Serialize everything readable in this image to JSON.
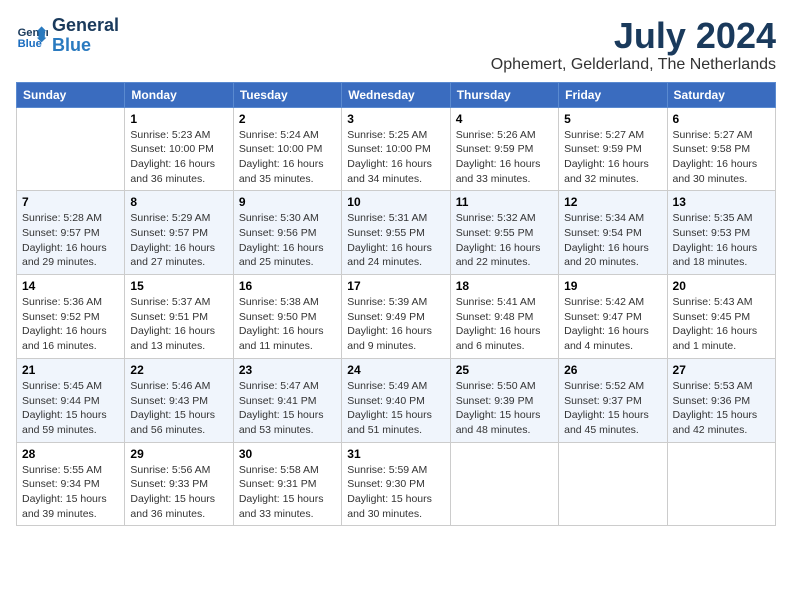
{
  "header": {
    "logo_line1": "General",
    "logo_line2": "Blue",
    "month_year": "July 2024",
    "location": "Ophemert, Gelderland, The Netherlands"
  },
  "days_of_week": [
    "Sunday",
    "Monday",
    "Tuesday",
    "Wednesday",
    "Thursday",
    "Friday",
    "Saturday"
  ],
  "weeks": [
    [
      {
        "day": "",
        "info": ""
      },
      {
        "day": "1",
        "info": "Sunrise: 5:23 AM\nSunset: 10:00 PM\nDaylight: 16 hours\nand 36 minutes."
      },
      {
        "day": "2",
        "info": "Sunrise: 5:24 AM\nSunset: 10:00 PM\nDaylight: 16 hours\nand 35 minutes."
      },
      {
        "day": "3",
        "info": "Sunrise: 5:25 AM\nSunset: 10:00 PM\nDaylight: 16 hours\nand 34 minutes."
      },
      {
        "day": "4",
        "info": "Sunrise: 5:26 AM\nSunset: 9:59 PM\nDaylight: 16 hours\nand 33 minutes."
      },
      {
        "day": "5",
        "info": "Sunrise: 5:27 AM\nSunset: 9:59 PM\nDaylight: 16 hours\nand 32 minutes."
      },
      {
        "day": "6",
        "info": "Sunrise: 5:27 AM\nSunset: 9:58 PM\nDaylight: 16 hours\nand 30 minutes."
      }
    ],
    [
      {
        "day": "7",
        "info": "Sunrise: 5:28 AM\nSunset: 9:57 PM\nDaylight: 16 hours\nand 29 minutes."
      },
      {
        "day": "8",
        "info": "Sunrise: 5:29 AM\nSunset: 9:57 PM\nDaylight: 16 hours\nand 27 minutes."
      },
      {
        "day": "9",
        "info": "Sunrise: 5:30 AM\nSunset: 9:56 PM\nDaylight: 16 hours\nand 25 minutes."
      },
      {
        "day": "10",
        "info": "Sunrise: 5:31 AM\nSunset: 9:55 PM\nDaylight: 16 hours\nand 24 minutes."
      },
      {
        "day": "11",
        "info": "Sunrise: 5:32 AM\nSunset: 9:55 PM\nDaylight: 16 hours\nand 22 minutes."
      },
      {
        "day": "12",
        "info": "Sunrise: 5:34 AM\nSunset: 9:54 PM\nDaylight: 16 hours\nand 20 minutes."
      },
      {
        "day": "13",
        "info": "Sunrise: 5:35 AM\nSunset: 9:53 PM\nDaylight: 16 hours\nand 18 minutes."
      }
    ],
    [
      {
        "day": "14",
        "info": "Sunrise: 5:36 AM\nSunset: 9:52 PM\nDaylight: 16 hours\nand 16 minutes."
      },
      {
        "day": "15",
        "info": "Sunrise: 5:37 AM\nSunset: 9:51 PM\nDaylight: 16 hours\nand 13 minutes."
      },
      {
        "day": "16",
        "info": "Sunrise: 5:38 AM\nSunset: 9:50 PM\nDaylight: 16 hours\nand 11 minutes."
      },
      {
        "day": "17",
        "info": "Sunrise: 5:39 AM\nSunset: 9:49 PM\nDaylight: 16 hours\nand 9 minutes."
      },
      {
        "day": "18",
        "info": "Sunrise: 5:41 AM\nSunset: 9:48 PM\nDaylight: 16 hours\nand 6 minutes."
      },
      {
        "day": "19",
        "info": "Sunrise: 5:42 AM\nSunset: 9:47 PM\nDaylight: 16 hours\nand 4 minutes."
      },
      {
        "day": "20",
        "info": "Sunrise: 5:43 AM\nSunset: 9:45 PM\nDaylight: 16 hours\nand 1 minute."
      }
    ],
    [
      {
        "day": "21",
        "info": "Sunrise: 5:45 AM\nSunset: 9:44 PM\nDaylight: 15 hours\nand 59 minutes."
      },
      {
        "day": "22",
        "info": "Sunrise: 5:46 AM\nSunset: 9:43 PM\nDaylight: 15 hours\nand 56 minutes."
      },
      {
        "day": "23",
        "info": "Sunrise: 5:47 AM\nSunset: 9:41 PM\nDaylight: 15 hours\nand 53 minutes."
      },
      {
        "day": "24",
        "info": "Sunrise: 5:49 AM\nSunset: 9:40 PM\nDaylight: 15 hours\nand 51 minutes."
      },
      {
        "day": "25",
        "info": "Sunrise: 5:50 AM\nSunset: 9:39 PM\nDaylight: 15 hours\nand 48 minutes."
      },
      {
        "day": "26",
        "info": "Sunrise: 5:52 AM\nSunset: 9:37 PM\nDaylight: 15 hours\nand 45 minutes."
      },
      {
        "day": "27",
        "info": "Sunrise: 5:53 AM\nSunset: 9:36 PM\nDaylight: 15 hours\nand 42 minutes."
      }
    ],
    [
      {
        "day": "28",
        "info": "Sunrise: 5:55 AM\nSunset: 9:34 PM\nDaylight: 15 hours\nand 39 minutes."
      },
      {
        "day": "29",
        "info": "Sunrise: 5:56 AM\nSunset: 9:33 PM\nDaylight: 15 hours\nand 36 minutes."
      },
      {
        "day": "30",
        "info": "Sunrise: 5:58 AM\nSunset: 9:31 PM\nDaylight: 15 hours\nand 33 minutes."
      },
      {
        "day": "31",
        "info": "Sunrise: 5:59 AM\nSunset: 9:30 PM\nDaylight: 15 hours\nand 30 minutes."
      },
      {
        "day": "",
        "info": ""
      },
      {
        "day": "",
        "info": ""
      },
      {
        "day": "",
        "info": ""
      }
    ]
  ]
}
